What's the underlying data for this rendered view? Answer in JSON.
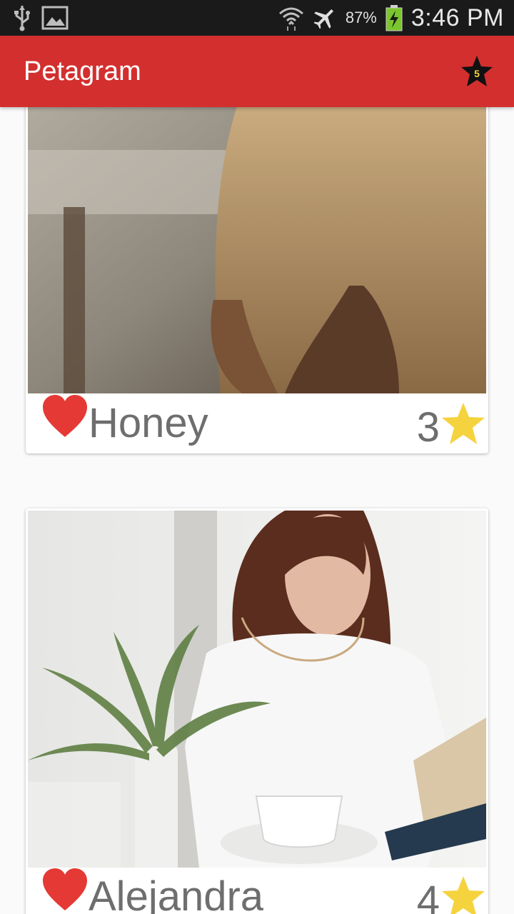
{
  "status_bar": {
    "left_icons": [
      "usb-icon",
      "image-icon"
    ],
    "right_icons": [
      "wifi-icon",
      "airplane-icon",
      "battery-icon"
    ],
    "battery_percent": "87%",
    "time": "3:46 PM"
  },
  "app_bar": {
    "title": "Petagram",
    "rated_badge_count": "5",
    "background_color": "#d32f2f"
  },
  "pets": [
    {
      "name": "Honey",
      "rating": "3",
      "photo_alt": "woman with long blonde hair near window"
    },
    {
      "name": "Alejandra",
      "rating": "4",
      "photo_alt": "woman in white shirt reading a book"
    }
  ],
  "colors": {
    "heart": "#e53935",
    "star": "#f5d33f",
    "name_text": "#6e6e6e"
  }
}
